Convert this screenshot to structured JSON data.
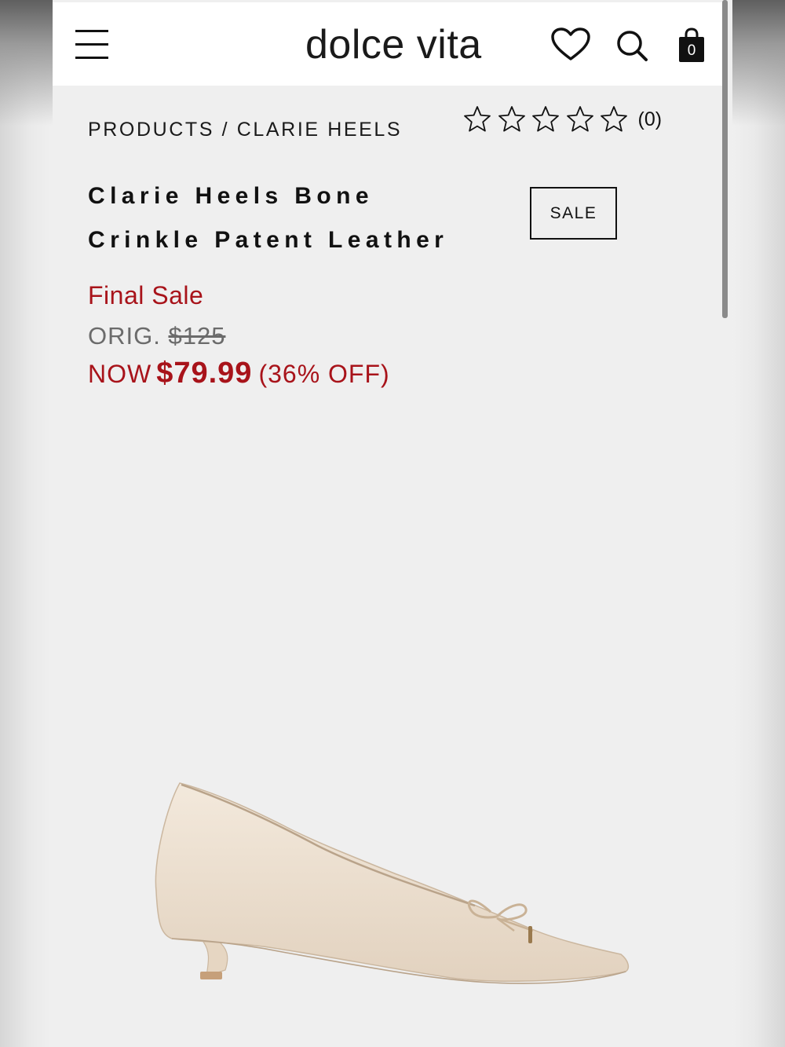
{
  "header": {
    "logo_text": "dolce vita",
    "bag_count": "0",
    "icons": [
      "menu-icon",
      "heart-icon",
      "search-icon",
      "bag-icon"
    ]
  },
  "breadcrumb": {
    "root": "PRODUCTS",
    "separator": "/",
    "current": "CLARIE HEELS"
  },
  "rating": {
    "stars_total": 5,
    "stars_filled": 0,
    "review_count_label": "(0)"
  },
  "product": {
    "title_line1": "Clarie Heels Bone",
    "title_line2": "Crinkle Patent Leather",
    "badge": "SALE",
    "final_sale_label": "Final Sale",
    "orig_label": "ORIG.",
    "orig_price": "$125",
    "now_label": "NOW",
    "now_price": "$79.99",
    "discount_label": "(36% OFF)",
    "image_icon": "pointed-kitten-heel-pump-with-bow"
  },
  "colors": {
    "sale_red": "#a8131a",
    "shoe_color": "#ecdfcf",
    "page_bg": "#efefef",
    "header_bg": "#ffffff"
  }
}
